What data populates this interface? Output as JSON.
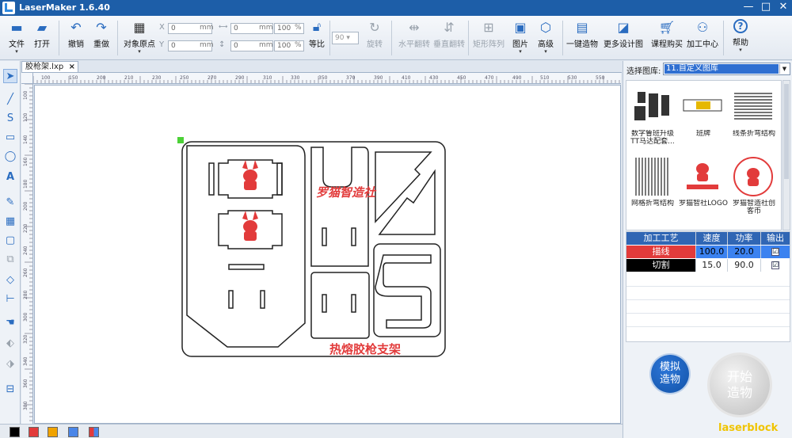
{
  "window": {
    "title": "LaserMaker 1.6.40",
    "controls": [
      "—",
      "□",
      "✕"
    ]
  },
  "toolbar": {
    "file": "文件",
    "open": "打开",
    "undo": "撤销",
    "redo": "重做",
    "origin": "对象原点",
    "x_label": "X",
    "y_label": "Y",
    "x_value": "0",
    "y_value": "0",
    "unit_mm": "mm",
    "w_value": "0",
    "h_value": "0",
    "w_pct": "100",
    "h_pct": "100",
    "pct": "%",
    "lock": "等比",
    "rotate_value": "90",
    "rotate": "旋转",
    "hflip": "水平翻转",
    "vflip": "垂直翻转",
    "array": "矩形阵列",
    "image": "图片",
    "advanced": "高级",
    "oneclick": "一键造物",
    "more_designs": "更多设计图",
    "course": "课程购买",
    "center": "加工中心",
    "help": "帮助"
  },
  "document": {
    "tab_name": "胶枪架.lxp",
    "tab_close": "×"
  },
  "ruler": {
    "h_ticks": [
      "100",
      "150",
      "200",
      "210",
      "230",
      "250",
      "270",
      "290",
      "310",
      "330",
      "350",
      "370",
      "390",
      "410",
      "430",
      "450",
      "470",
      "490",
      "510",
      "530",
      "550"
    ],
    "v_ticks": [
      "100",
      "120",
      "140",
      "160",
      "180",
      "200",
      "220",
      "240",
      "260",
      "280",
      "300",
      "320",
      "340",
      "360",
      "380"
    ]
  },
  "design": {
    "title_text": "热熔胶枪支架",
    "logo_text": "罗猫智造社"
  },
  "library": {
    "label": "选择图库:",
    "selected": "11.自定义图库",
    "items": [
      {
        "caption": "数字鲁班升级TT马达配套...",
        "icon": "robot-icon"
      },
      {
        "caption": "班牌",
        "icon": "nameplate-icon"
      },
      {
        "caption": "线条折弯结构",
        "icon": "lines-icon"
      },
      {
        "caption": "网格折弯结构",
        "icon": "grid-icon"
      },
      {
        "caption": "罗猫智社LOGO",
        "icon": "logo-icon"
      },
      {
        "caption": "罗猫智造社创客币",
        "icon": "coin-icon"
      }
    ]
  },
  "process": {
    "headers": [
      "加工工艺",
      "速度",
      "功率",
      "输出"
    ],
    "rows": [
      {
        "name": "描线",
        "speed": "100.0",
        "power": "20.0",
        "output": "☑",
        "color": "#e23b3b"
      },
      {
        "name": "切割",
        "speed": "15.0",
        "power": "90.0",
        "output": "☑",
        "color": "#000000"
      }
    ]
  },
  "actions": {
    "simulate": "模拟\n造物",
    "simulate_l1": "模拟",
    "simulate_l2": "造物",
    "start_l1": "开始",
    "start_l2": "造物"
  },
  "palette": [
    "#000000",
    "#e23b3b",
    "#f0a300",
    "#4a86e8",
    "#mixed"
  ],
  "watermark": "laserblock"
}
